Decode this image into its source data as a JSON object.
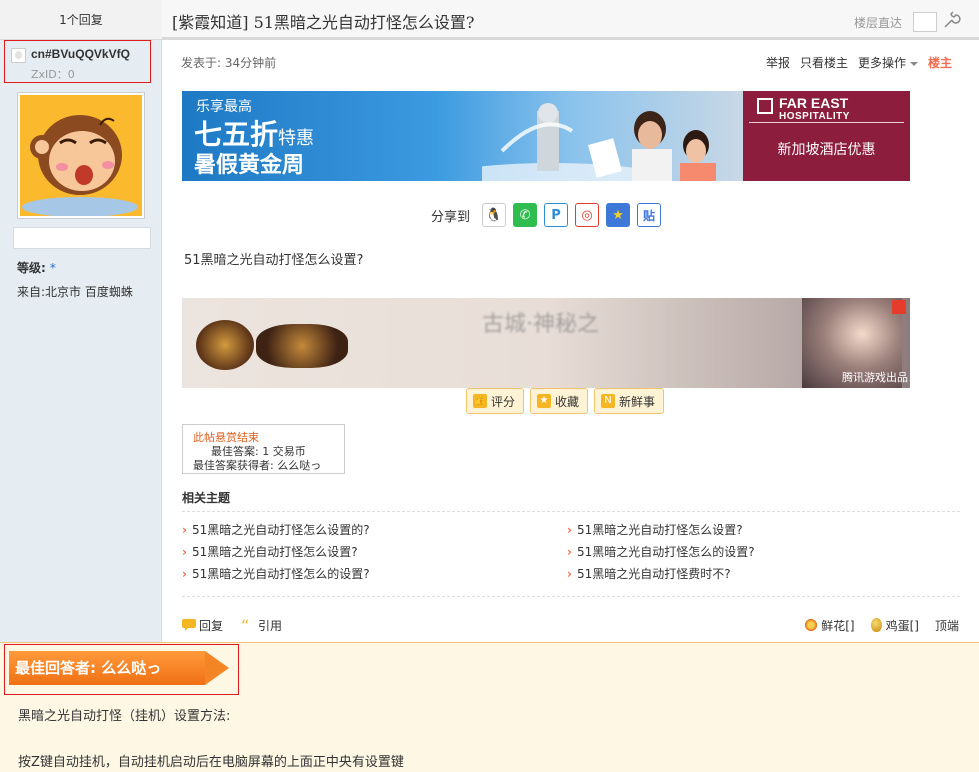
{
  "sidebar": {
    "reply_count": "1个回复",
    "username": "cn#BVuQQVkVfQ",
    "zxid": "ZxID：0",
    "level_label": "等级:",
    "level_value": "*",
    "from": "来自:北京市 百度蜘蛛"
  },
  "header": {
    "title": "[紫霞知道] 51黑暗之光自动打怪怎么设置?",
    "floor_jump": "楼层直达"
  },
  "post": {
    "posted": "发表于: 34分钟前",
    "actions": {
      "report": "举报",
      "only_op": "只看楼主",
      "more": "更多操作",
      "op": "楼主"
    },
    "question": "51黑暗之光自动打怪怎么设置?"
  },
  "ad_hotel": {
    "line1": "乐享最高",
    "line2_big": "七五折",
    "line2_small": "特惠",
    "line3": "暑假黄金周",
    "brand_line1": "FAR EAST",
    "brand_line2": "HOSPITALITY",
    "right_text": "新加坡酒店优惠"
  },
  "share": {
    "label": "分享到",
    "icons": [
      {
        "name": "qq-icon",
        "glyph": "Q",
        "color": "#2b2b2b"
      },
      {
        "name": "wechat-icon",
        "glyph": "◉",
        "color": "#2ebd4e"
      },
      {
        "name": "tencent-weibo-icon",
        "glyph": "P",
        "color": "#2c8fd6"
      },
      {
        "name": "sina-weibo-icon",
        "glyph": "◎",
        "color": "#e63b2e"
      },
      {
        "name": "qzone-icon",
        "glyph": "★",
        "color": "#f5b623"
      },
      {
        "name": "tieba-icon",
        "glyph": "贴",
        "color": "#3e78d8"
      }
    ]
  },
  "ad_game": {
    "blurred_text": "古城·神秘之",
    "tag": "腾讯游戏出品"
  },
  "buttons": {
    "rate": "评分",
    "favorite": "收藏",
    "news": "新鲜事"
  },
  "reward": {
    "title": "此帖悬赏结束",
    "best_answer": "最佳答案: 1 交易币",
    "winner": "最佳答案获得者: 么么哒っ"
  },
  "related": {
    "heading": "相关主题",
    "items": [
      "51黑暗之光自动打怪怎么设置的?",
      "51黑暗之光自动打怪怎么设置?",
      "51黑暗之光自动打怪怎么设置?",
      "51黑暗之光自动打怪怎么的设置?",
      "51黑暗之光自动打怪怎么的设置?",
      "51黑暗之光自动打怪费时不?"
    ]
  },
  "footer": {
    "reply": "回复",
    "quote": "引用",
    "flowers": "鲜花[]",
    "eggs": "鸡蛋[]",
    "top": "顶端"
  },
  "best_answer": {
    "tag": "最佳回答者: 么么哒っ",
    "p1": "黑暗之光自动打怪（挂机）设置方法:",
    "p2": "按Z键自动挂机，自动挂机启动后在电脑屏幕的上面正中央有设置键"
  },
  "colors": {
    "accent": "#f26c4f",
    "sidebar_bg": "#e5edf2",
    "best_bg": "#fdf7e4",
    "highlight_border": "#e0191f"
  }
}
